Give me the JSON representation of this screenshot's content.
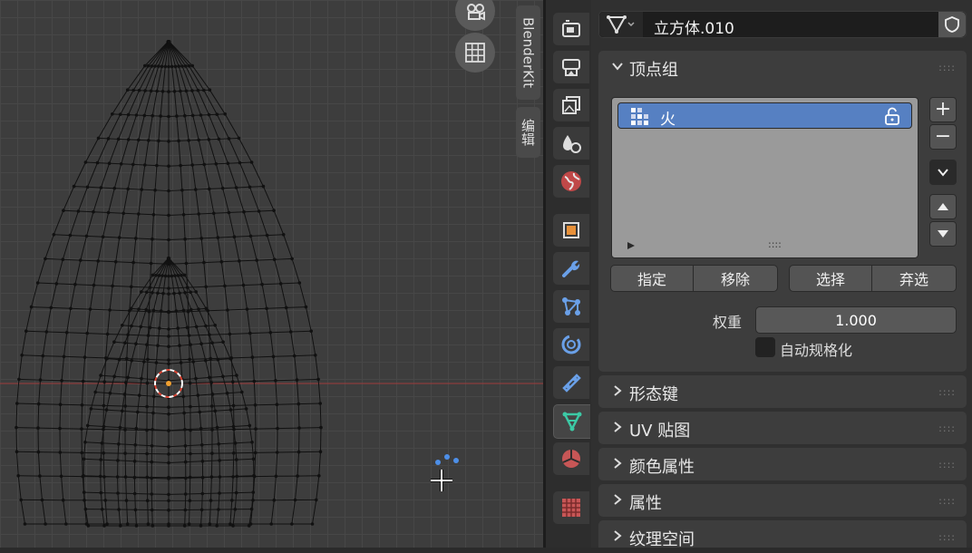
{
  "viewport": {
    "n_panel_tabs": [
      "BlenderKit",
      "编辑"
    ]
  },
  "properties_tabs": [
    "render-icon",
    "output-icon",
    "view-layer-icon",
    "scene-icon",
    "world-icon",
    "object-icon",
    "modifier-icon",
    "particles-icon",
    "physics-icon",
    "constraints-icon",
    "data-icon",
    "material-icon",
    "texture-icon"
  ],
  "header": {
    "object_name": "立方体.010"
  },
  "vertex_groups_panel": {
    "title": "顶点组",
    "groups": [
      {
        "name": "火"
      }
    ],
    "buttons": {
      "assign": "指定",
      "remove": "移除",
      "select": "选择",
      "deselect": "弃选"
    },
    "weight_label": "权重",
    "weight_value": "1.000",
    "auto_normalize_label": "自动规格化",
    "auto_normalize": false
  },
  "collapsed_panels": [
    {
      "title": "形态键"
    },
    {
      "title": "UV 贴图"
    },
    {
      "title": "颜色属性"
    },
    {
      "title": "属性"
    },
    {
      "title": "纹理空间"
    }
  ],
  "colors": {
    "accent_selected": "#5680c2",
    "panel_bg": "#3d3d3d"
  }
}
